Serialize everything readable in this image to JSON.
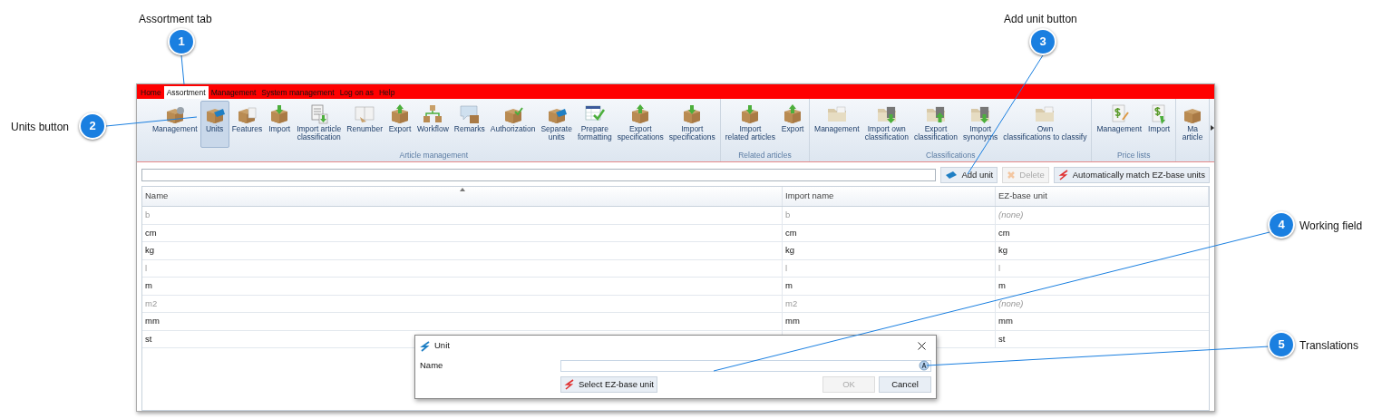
{
  "callouts": [
    {
      "number": "1",
      "label": "Assortment tab"
    },
    {
      "number": "2",
      "label": "Units button"
    },
    {
      "number": "3",
      "label": "Add unit button"
    },
    {
      "number": "4",
      "label": "Working field"
    },
    {
      "number": "5",
      "label": "Translations"
    }
  ],
  "menu": [
    {
      "label": "Home",
      "selected": false
    },
    {
      "label": "Assortment",
      "selected": true
    },
    {
      "label": "Management",
      "selected": false
    },
    {
      "label": "System management",
      "selected": false
    },
    {
      "label": "Log on as",
      "selected": false
    },
    {
      "label": "Help",
      "selected": false
    }
  ],
  "ribbon_groups": [
    {
      "title": "Article management",
      "items": [
        {
          "label": "Management",
          "selected": false
        },
        {
          "label": "Units",
          "selected": true
        },
        {
          "label": "Features",
          "selected": false
        },
        {
          "label": "Import",
          "selected": false
        },
        {
          "label": "Import article\nclassification",
          "selected": false
        },
        {
          "label": "Renumber",
          "selected": false
        },
        {
          "label": "Export",
          "selected": false
        },
        {
          "label": "Workflow",
          "selected": false
        },
        {
          "label": "Remarks",
          "selected": false
        },
        {
          "label": "Authorization",
          "selected": false
        },
        {
          "label": "Separate\nunits",
          "selected": false
        },
        {
          "label": "Prepare\nformatting",
          "selected": false
        },
        {
          "label": "Export\nspecifications",
          "selected": false
        },
        {
          "label": "Import\nspecifications",
          "selected": false
        }
      ]
    },
    {
      "title": "Related articles",
      "items": [
        {
          "label": "Import\nrelated articles",
          "selected": false
        },
        {
          "label": "Export",
          "selected": false
        }
      ]
    },
    {
      "title": "Classifications",
      "items": [
        {
          "label": "Management",
          "selected": false
        },
        {
          "label": "Import own\nclassification",
          "selected": false
        },
        {
          "label": "Export\nclassification",
          "selected": false
        },
        {
          "label": "Import\nsynonyms",
          "selected": false
        },
        {
          "label": "Own\nclassifications to classify",
          "selected": false
        }
      ]
    },
    {
      "title": "Price lists",
      "items": [
        {
          "label": "Management",
          "selected": false
        },
        {
          "label": "Import",
          "selected": false
        }
      ]
    },
    {
      "items": [
        {
          "label": "Ma\narticle",
          "selected": false
        }
      ]
    }
  ],
  "toolbar": {
    "buttons": [
      {
        "label": "Add unit",
        "disabled": false
      },
      {
        "label": "Delete",
        "disabled": true
      },
      {
        "label": "Automatically match EZ-base units",
        "disabled": false
      }
    ]
  },
  "table": {
    "columns": [
      "Name",
      "Import name",
      "EZ-base unit"
    ],
    "rows": [
      {
        "name": "b",
        "import_name": "b",
        "ez_base_unit": "(none)",
        "inactive": true,
        "unassigned": true
      },
      {
        "name": "cm",
        "import_name": "cm",
        "ez_base_unit": "cm",
        "inactive": false,
        "unassigned": false
      },
      {
        "name": "kg",
        "import_name": "kg",
        "ez_base_unit": "kg",
        "inactive": false,
        "unassigned": false
      },
      {
        "name": "l",
        "import_name": "l",
        "ez_base_unit": "l",
        "inactive": true,
        "unassigned": false
      },
      {
        "name": "m",
        "import_name": "m",
        "ez_base_unit": "m",
        "inactive": false,
        "unassigned": false
      },
      {
        "name": "m2",
        "import_name": "m2",
        "ez_base_unit": "(none)",
        "inactive": true,
        "unassigned": true
      },
      {
        "name": "mm",
        "import_name": "mm",
        "ez_base_unit": "mm",
        "inactive": false,
        "unassigned": false
      },
      {
        "name": "st",
        "ez_base_unit": "st",
        "inactive": false,
        "unassigned": false
      }
    ]
  },
  "dialog": {
    "title": "Unit",
    "field_label": "Name",
    "select_button": "Select EZ-base unit",
    "buttons": [
      {
        "label": "OK",
        "disabled": true
      },
      {
        "label": "Cancel",
        "disabled": false
      }
    ]
  }
}
